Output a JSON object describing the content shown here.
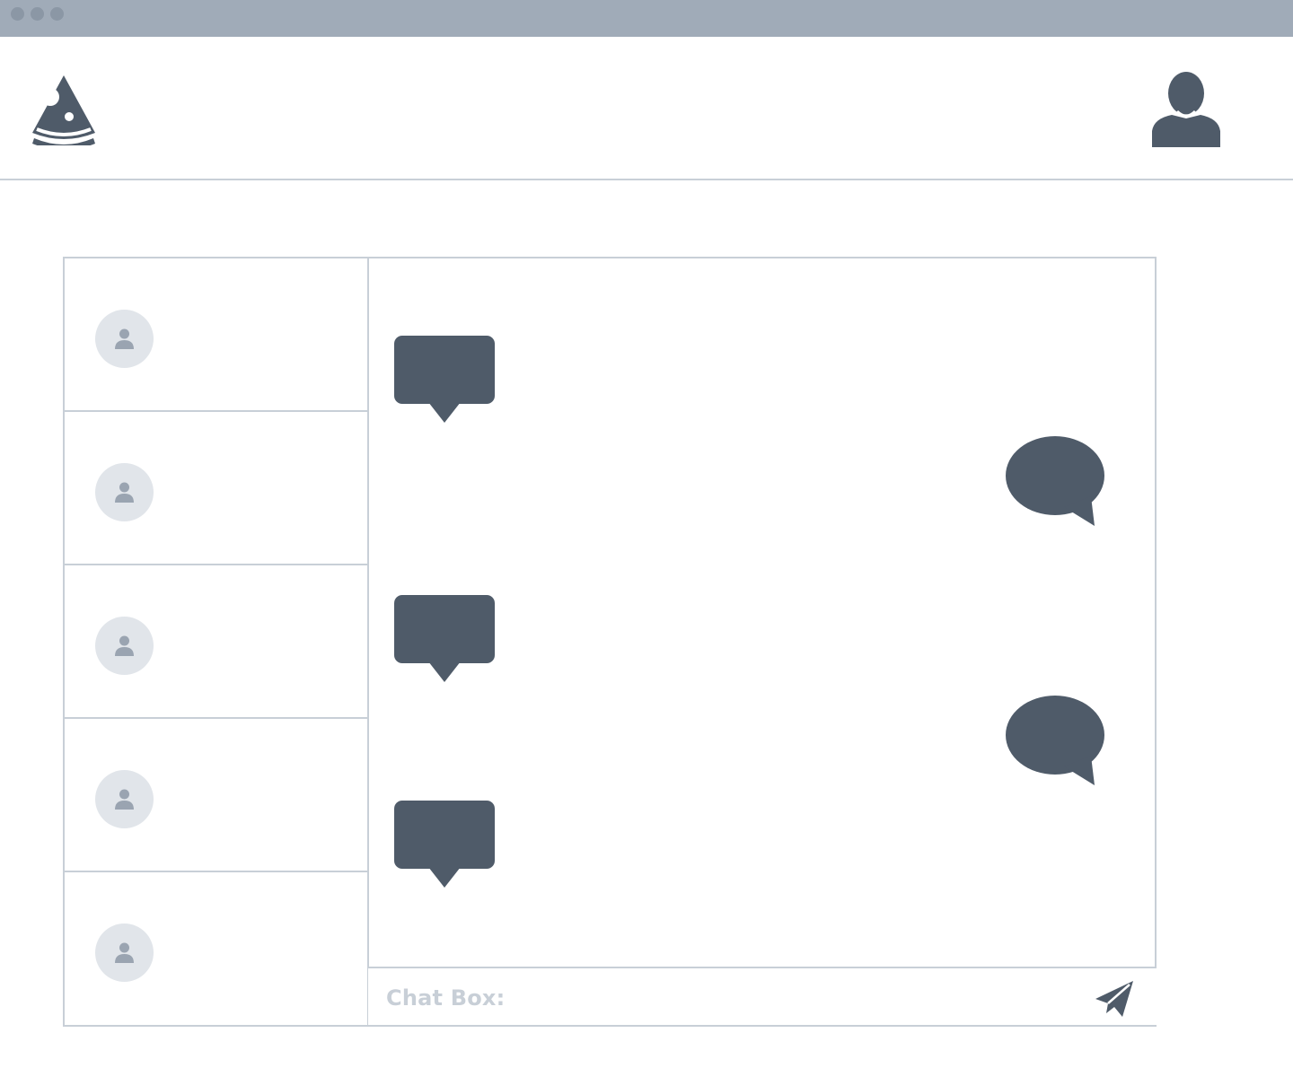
{
  "window": {
    "traffic_lights": [
      "close",
      "minimize",
      "maximize"
    ]
  },
  "header": {
    "logo_icon": "pizza-slice-icon",
    "profile_icon": "user-silhouette-icon"
  },
  "contacts": [
    {
      "avatar_icon": "user-icon"
    },
    {
      "avatar_icon": "user-icon"
    },
    {
      "avatar_icon": "user-icon"
    },
    {
      "avatar_icon": "user-icon"
    },
    {
      "avatar_icon": "user-icon"
    }
  ],
  "messages": [
    {
      "side": "left",
      "shape": "rect-bubble"
    },
    {
      "side": "right",
      "shape": "round-bubble"
    },
    {
      "side": "left",
      "shape": "rect-bubble"
    },
    {
      "side": "right",
      "shape": "round-bubble"
    },
    {
      "side": "left",
      "shape": "rect-bubble"
    }
  ],
  "chatbox": {
    "label": "Chat Box:",
    "value": "",
    "send_icon": "paper-plane-icon"
  },
  "colors": {
    "primary": "#4f5b69",
    "border": "#c8cfd7",
    "titlebar": "#a0abb8",
    "avatar_bg": "#e1e5ea"
  }
}
